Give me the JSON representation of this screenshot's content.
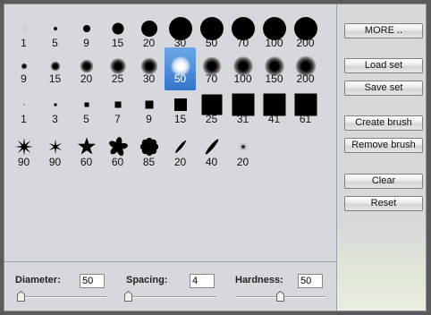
{
  "brushes": {
    "row1": [
      {
        "kind": "circle",
        "label": "1",
        "size": 1
      },
      {
        "kind": "circle",
        "label": "5",
        "size": 4
      },
      {
        "kind": "circle",
        "label": "9",
        "size": 8
      },
      {
        "kind": "circle",
        "label": "15",
        "size": 13
      },
      {
        "kind": "circle",
        "label": "20",
        "size": 18
      },
      {
        "kind": "circle",
        "label": "30",
        "size": 26
      },
      {
        "kind": "circle",
        "label": "50",
        "size": 26
      },
      {
        "kind": "circle",
        "label": "70",
        "size": 26
      },
      {
        "kind": "circle",
        "label": "100",
        "size": 26
      },
      {
        "kind": "circle",
        "label": "200",
        "size": 26
      }
    ],
    "row2": [
      {
        "kind": "soft",
        "label": "9",
        "size": 7
      },
      {
        "kind": "soft",
        "label": "15",
        "size": 11
      },
      {
        "kind": "soft",
        "label": "20",
        "size": 15
      },
      {
        "kind": "soft",
        "label": "25",
        "size": 18
      },
      {
        "kind": "soft",
        "label": "30",
        "size": 19
      },
      {
        "kind": "soft",
        "label": "50",
        "size": 22,
        "selected": true
      },
      {
        "kind": "soft",
        "label": "70",
        "size": 21
      },
      {
        "kind": "soft",
        "label": "100",
        "size": 22
      },
      {
        "kind": "soft",
        "label": "150",
        "size": 22
      },
      {
        "kind": "soft",
        "label": "200",
        "size": 23
      }
    ],
    "row3": [
      {
        "kind": "square",
        "label": "1",
        "size": 1
      },
      {
        "kind": "square",
        "label": "3",
        "size": 3
      },
      {
        "kind": "square",
        "label": "5",
        "size": 5
      },
      {
        "kind": "square",
        "label": "7",
        "size": 7
      },
      {
        "kind": "square",
        "label": "9",
        "size": 9
      },
      {
        "kind": "square",
        "label": "15",
        "size": 14
      },
      {
        "kind": "square",
        "label": "25",
        "size": 23
      },
      {
        "kind": "square",
        "label": "31",
        "size": 25
      },
      {
        "kind": "square",
        "label": "41",
        "size": 25
      },
      {
        "kind": "square",
        "label": "61",
        "size": 25
      }
    ],
    "row4": [
      {
        "kind": "star8",
        "label": "90",
        "size": 22
      },
      {
        "kind": "star4",
        "label": "90",
        "size": 18
      },
      {
        "kind": "star5",
        "label": "60",
        "size": 22
      },
      {
        "kind": "flower5",
        "label": "60",
        "size": 22
      },
      {
        "kind": "flower8",
        "label": "85",
        "size": 22
      },
      {
        "kind": "leaf",
        "label": "20",
        "size": 18
      },
      {
        "kind": "leaf",
        "label": "40",
        "size": 22
      },
      {
        "kind": "splat",
        "label": "20",
        "size": 14
      }
    ]
  },
  "buttons": {
    "more": "MORE ..",
    "load_set": "Load set",
    "save_set": "Save set",
    "create_brush": "Create brush",
    "remove_brush": "Remove brush",
    "clear": "Clear",
    "reset": "Reset"
  },
  "params": {
    "diameter_label": "Diameter:",
    "diameter_value": "50",
    "spacing_label": "Spacing:",
    "spacing_value": "4",
    "hardness_label": "Hardness:",
    "hardness_value": "50"
  },
  "icons": {
    "slider_thumb": "slider-thumb-icon"
  }
}
